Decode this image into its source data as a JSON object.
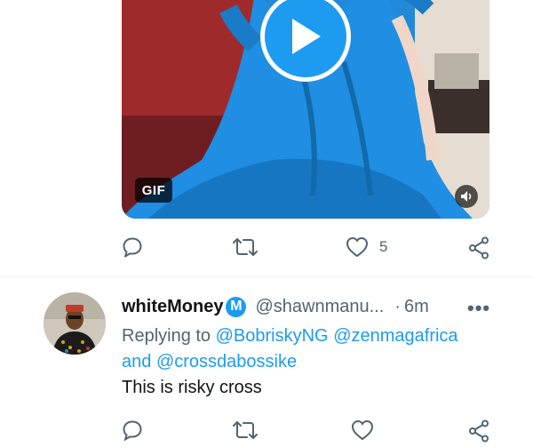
{
  "media": {
    "gif_label": "GIF",
    "icons": [
      "play-icon",
      "volume-icon"
    ]
  },
  "actions_top": {
    "reply_icon": "comment-icon",
    "retweet_icon": "retweet-icon",
    "like_icon": "heart-icon",
    "like_count": "5",
    "share_icon": "share-icon"
  },
  "reply_tweet": {
    "display_name": "whiteMoney",
    "badge_letter": "M",
    "handle": "@shawnmanu...",
    "separator": "·",
    "time": "6m",
    "more_label": "•••",
    "replying_prefix": "Replying to",
    "mention_1": "@BobriskyNG",
    "mention_2": "@zenmagafrica",
    "and_text": "and",
    "mention_3": "@crossdabossike",
    "text": "This is risky cross"
  },
  "colors": {
    "accent": "#1d9bf0",
    "secondary_text": "#536471",
    "primary_text": "#0f1419"
  }
}
